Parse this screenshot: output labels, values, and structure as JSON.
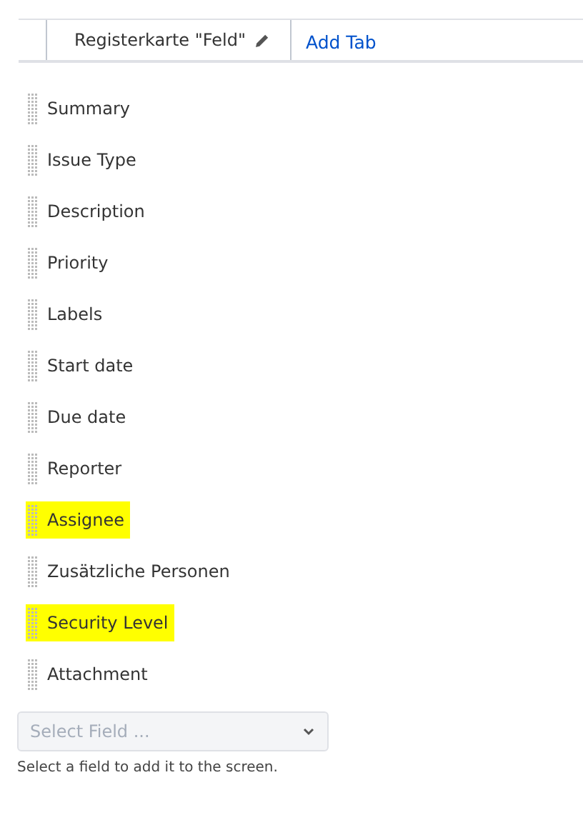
{
  "tabs": [
    {
      "label": "Registerkarte \"Feld\"",
      "selected": true,
      "editable": true
    }
  ],
  "add_tab": "Add Tab",
  "fields": [
    {
      "label": "Summary",
      "highlighted": false
    },
    {
      "label": "Issue Type",
      "highlighted": false
    },
    {
      "label": "Description",
      "highlighted": false
    },
    {
      "label": "Priority",
      "highlighted": false
    },
    {
      "label": "Labels",
      "highlighted": false
    },
    {
      "label": "Start date",
      "highlighted": false
    },
    {
      "label": "Due date",
      "highlighted": false
    },
    {
      "label": "Reporter",
      "highlighted": false
    },
    {
      "label": "Assignee",
      "highlighted": true
    },
    {
      "label": "Zusätzliche Personen",
      "highlighted": false
    },
    {
      "label": "Security Level",
      "highlighted": true
    },
    {
      "label": "Attachment",
      "highlighted": false
    }
  ],
  "select_field": {
    "placeholder": "Select Field ...",
    "hint": "Select a field to add it to the screen."
  }
}
